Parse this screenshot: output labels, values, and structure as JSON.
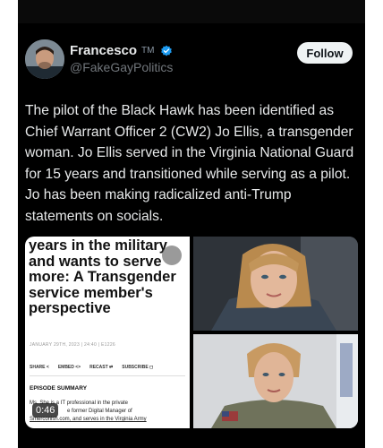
{
  "author": {
    "display_name": "Francesco",
    "name_badge": "TM",
    "handle": "@FakeGayPolitics",
    "verified_icon": "verified-badge-icon"
  },
  "actions": {
    "follow_label": "Follow"
  },
  "tweet": {
    "text": "The pilot of the Black Hawk has been identified as Chief Warrant Officer 2 (CW2) Jo Ellis, a transgender woman. Jo Ellis served in the Virginia National Guard for 15 years and transitioned while serving as a pilot. Jo has been making radicalized anti-Trump statements on socials."
  },
  "media": {
    "article_card": {
      "headline": "years in the military and wants to serve more: A Transgender service member's perspective",
      "date": "JANUARY 29TH, 2023 | 24:40 | E1226",
      "actions": [
        "SHARE <",
        "EMBED <>",
        "RECAST ⇄",
        "SUBSCRIBE ◻"
      ],
      "section": "EPISODE SUMMARY",
      "body_prefix": "M",
      "body_1": "s. She is a IT professional in the private",
      "body_2": "e former Digital Manager of",
      "body_3": "Smerconish.com, and serves in the Virginia Army",
      "video_duration": "0:46"
    }
  },
  "colors": {
    "background": "#000000",
    "text": "#e7e9ea",
    "muted": "#71767b",
    "verified": "#1d9bf0",
    "follow_bg": "#eff3f4"
  }
}
